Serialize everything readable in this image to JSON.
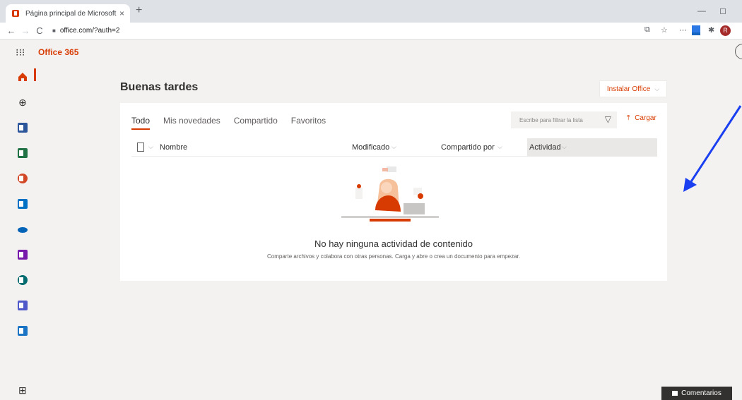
{
  "browser": {
    "tab_title": "Página principal de Microsoft Office",
    "tab_close": "×",
    "new_tab": "+",
    "url": "office.com/?auth=2",
    "avatar_initial": "R",
    "minimize": "—",
    "restore": "◻"
  },
  "header": {
    "brand": "Office 365"
  },
  "main": {
    "greeting": "Buenas tardes",
    "install_label": "Instalar Office",
    "tabs": [
      "Todo",
      "Mis novedades",
      "Compartido",
      "Favoritos"
    ],
    "filter_placeholder": "Escribe para filtrar la lista",
    "upload_label": "Cargar",
    "columns": [
      "Nombre",
      "Modificado",
      "Compartido por",
      "Actividad"
    ],
    "empty_title": "No hay ninguna actividad de contenido",
    "empty_subtitle": "Comparte archivos y colabora con otras personas. Carga y abre o crea un documento para empezar."
  },
  "feedback": {
    "label": "Comentarios"
  },
  "colors": {
    "accent": "#d83b01",
    "arrow": "#1a3ff0"
  }
}
